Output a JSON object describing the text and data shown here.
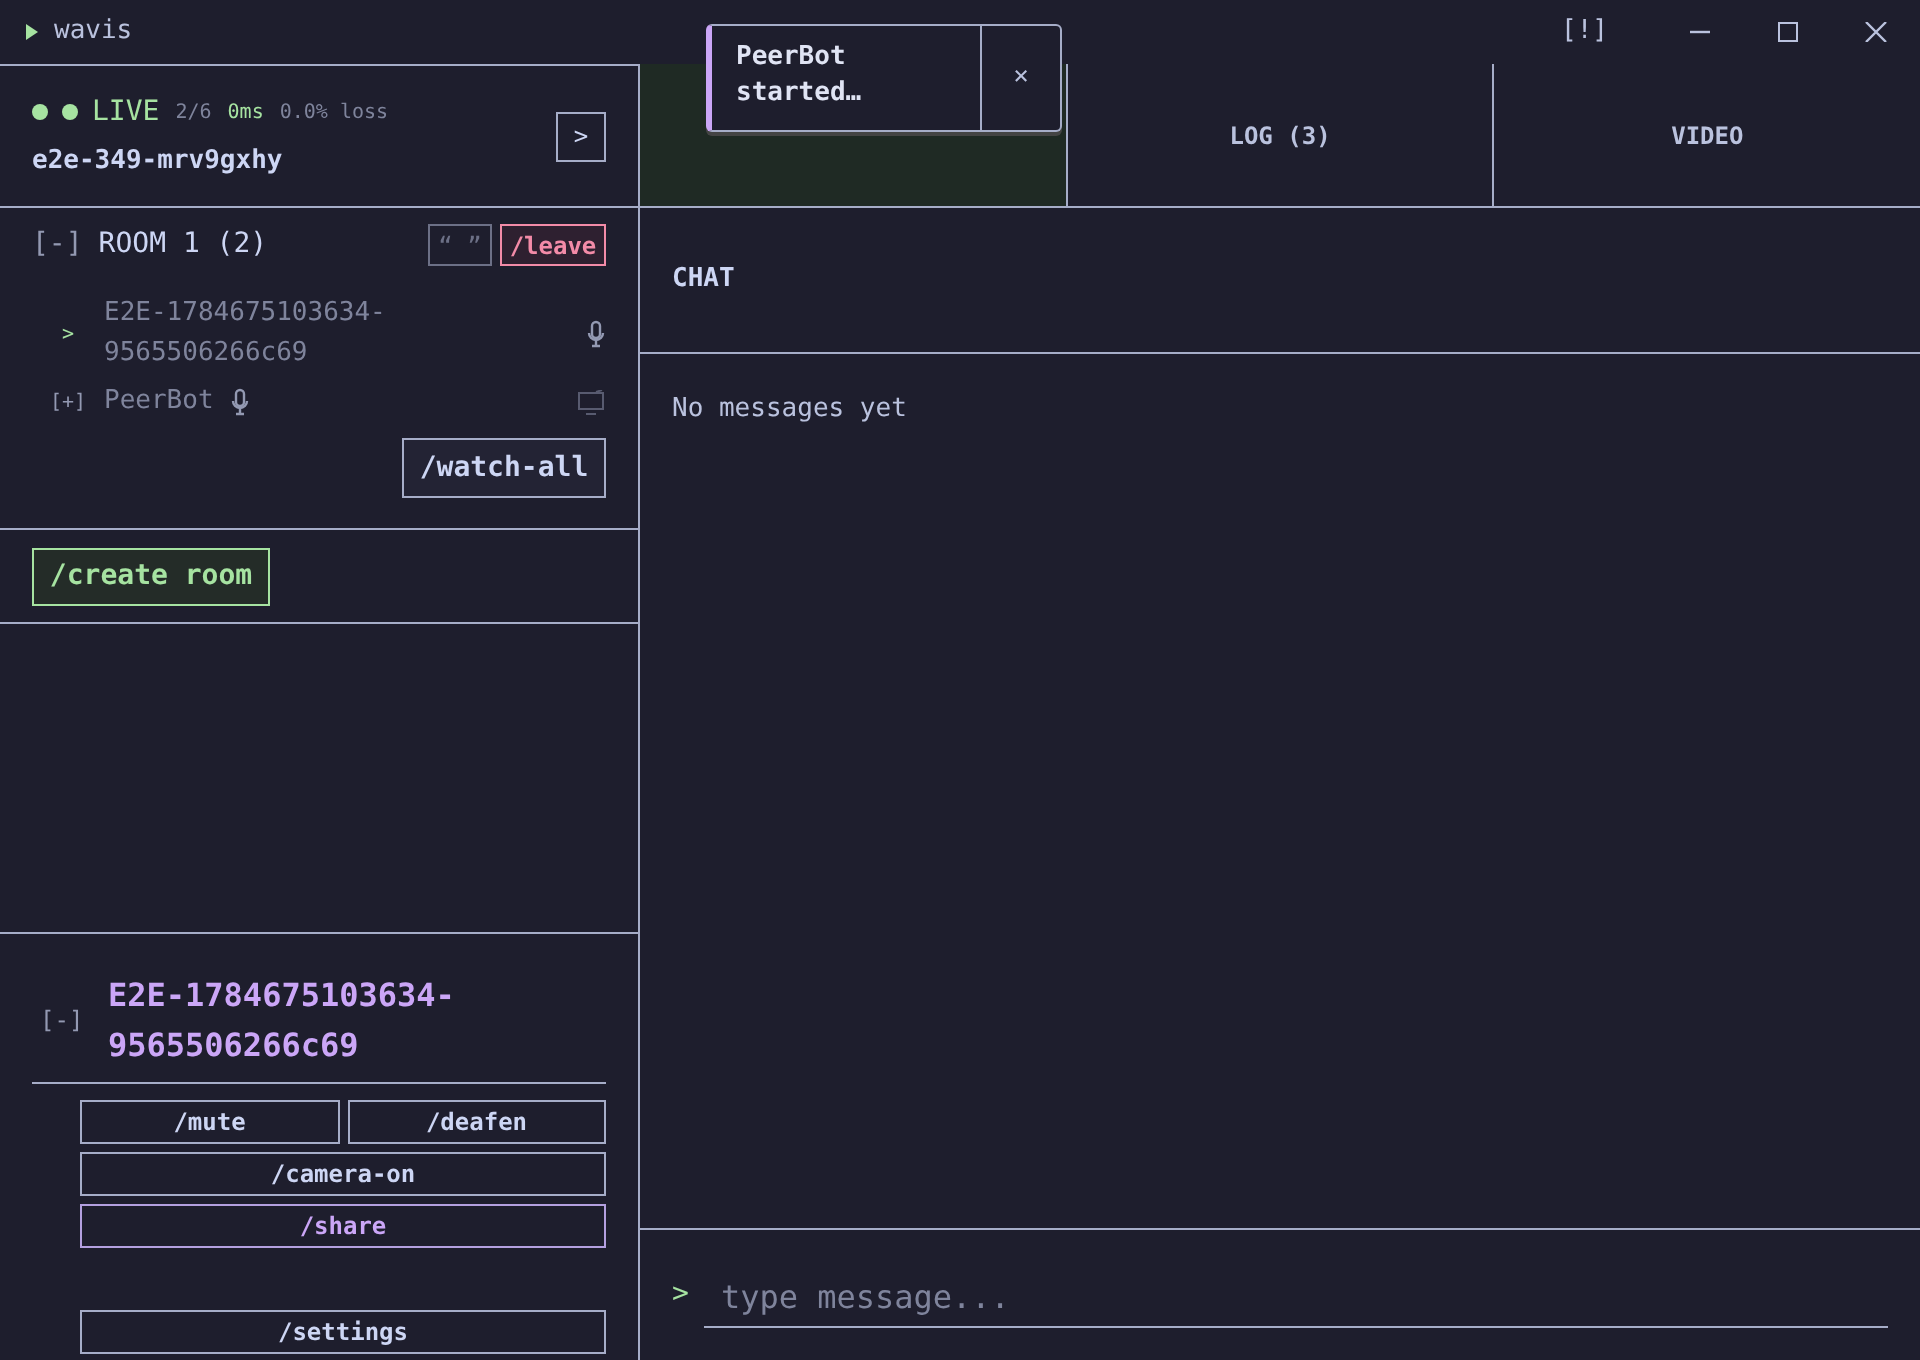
{
  "window": {
    "title": "wavis",
    "alert": "[!]"
  },
  "session": {
    "status_dots": [
      {
        "color": "#a6e3a1"
      },
      {
        "color": "#a6e3a1"
      }
    ],
    "live": "LIVE",
    "peers": "2/6",
    "latency": "0ms",
    "loss": "0.0% loss",
    "name": "e2e-349-mrv9gxhy",
    "expand_button": ">"
  },
  "room": {
    "toggle": "[-]",
    "title": "ROOM 1 (2)",
    "quote_button": "“ ”",
    "leave_button": "/leave",
    "watch_button": "/watch-all",
    "members": [
      {
        "kind": "self",
        "marker": ">",
        "name": "E2E-1784675103634-9565506266c69"
      },
      {
        "kind": "peer",
        "marker": "[+]",
        "name": "PeerBot"
      }
    ]
  },
  "create_room_button": "/create room",
  "user": {
    "toggle": "[-]",
    "name": "E2E-1784675103634-9565506266c69",
    "buttons": [
      {
        "label": "/mute",
        "kind": "half"
      },
      {
        "label": "/deafen",
        "kind": "half"
      },
      {
        "label": "/camera-on",
        "kind": "full"
      },
      {
        "label": "/share",
        "kind": "accent"
      },
      {
        "label": "/settings",
        "kind": "spaced"
      }
    ]
  },
  "tabs": [
    {
      "selected": true
    },
    {
      "label": "LOG (3)",
      "selected": false
    },
    {
      "label": "VIDEO",
      "selected": false
    }
  ],
  "toast": {
    "message": "PeerBot started…",
    "close": "×"
  },
  "chat": {
    "title": "CHAT",
    "empty": "No messages yet",
    "prompt": ">",
    "placeholder": "type message..."
  }
}
